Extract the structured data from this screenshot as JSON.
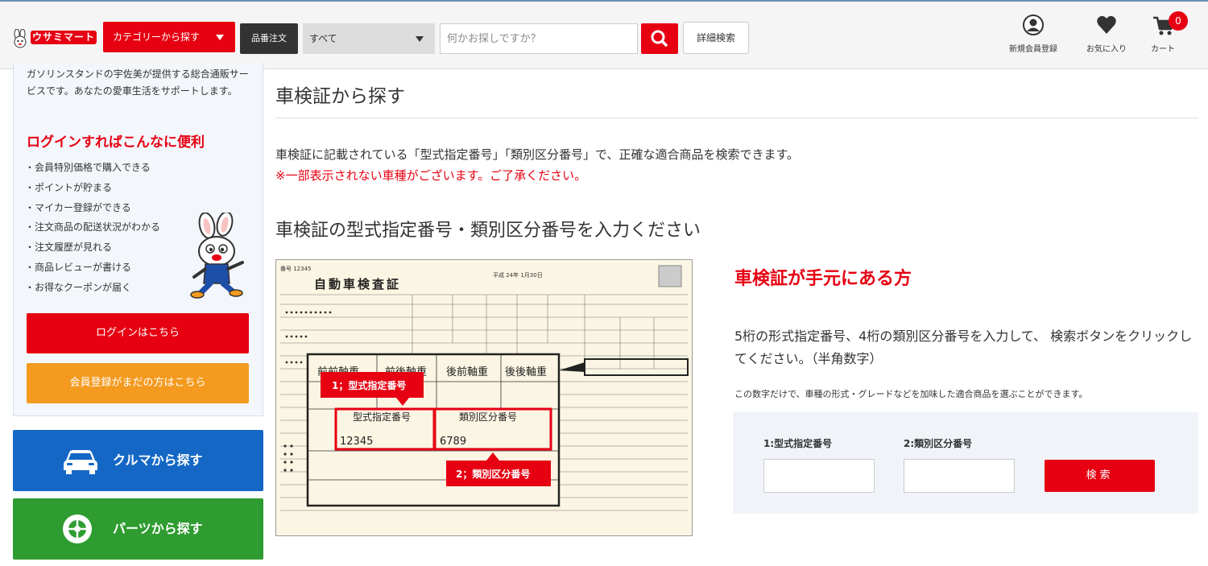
{
  "header": {
    "logo_text": "ウサミマート",
    "category_label": "カテゴリーから探す",
    "hinban_label": "品番注文",
    "scope_selected": "すべて",
    "search_placeholder": "何かお探しですか？",
    "detail_search_label": "詳細検索",
    "register_label": "新規会員登録",
    "favorites_label": "お気に入り",
    "cart_label": "カート",
    "cart_count": "0"
  },
  "sidebar": {
    "intro": "ガソリンスタンドの宇佐美が提供する総合通販サービスです。あなたの愛車生活をサポートします。",
    "heading": "ログインすればこんなに便利",
    "benefits": [
      "・会員特別価格で購入できる",
      "・ポイントが貯まる",
      "・マイカー登録ができる",
      "・注文商品の配送状況がわかる",
      "・注文履歴が見れる",
      "・商品レビューが書ける",
      "・お得なクーポンが届く"
    ],
    "login_label": "ログインはこちら",
    "register_label": "会員登録がまだの方はこちら",
    "car_nav_label": "クルマから探す",
    "parts_nav_label": "パーツから探す"
  },
  "main": {
    "title": "車検証から探す",
    "description": "車検証に記載されている「型式指定番号」「類別区分番号」で、正確な適合商品を検索できます。",
    "note": "※一部表示されない車種がございます。ご了承ください。",
    "subtitle": "車検証の型式指定番号・類別区分番号を入力ください",
    "certificate": {
      "title": "自動車検査証",
      "number": "番号  12345",
      "date": "平成 24年 1月30日",
      "col_front_front": "前前軸重",
      "col_front_rear": "前後軸重",
      "col_rear_front": "後前軸重",
      "col_rear_rear": "後後軸重",
      "callout1": "1；型式指定番号",
      "callout2": "2；類別区分番号",
      "field1_label": "型式指定番号",
      "field2_label": "類別区分番号",
      "field1_value": "12345",
      "field2_value": "6789"
    },
    "right_heading": "車検証が手元にある方",
    "instruction": "5桁の形式指定番号、4桁の類別区分番号を入力して、 検索ボタンをクリックしてください。（半角数字）",
    "small_note": "この数字だけで、車種の形式・グレードなどを加味した適合商品を選ぶことができます。",
    "form": {
      "field1_label": "1:型式指定番号",
      "field2_label": "2:類別区分番号",
      "submit_label": "検索"
    }
  },
  "colors": {
    "brand_red": "#e60012",
    "orange": "#f39a1f",
    "blue": "#1467c4",
    "green": "#2e9c30"
  }
}
